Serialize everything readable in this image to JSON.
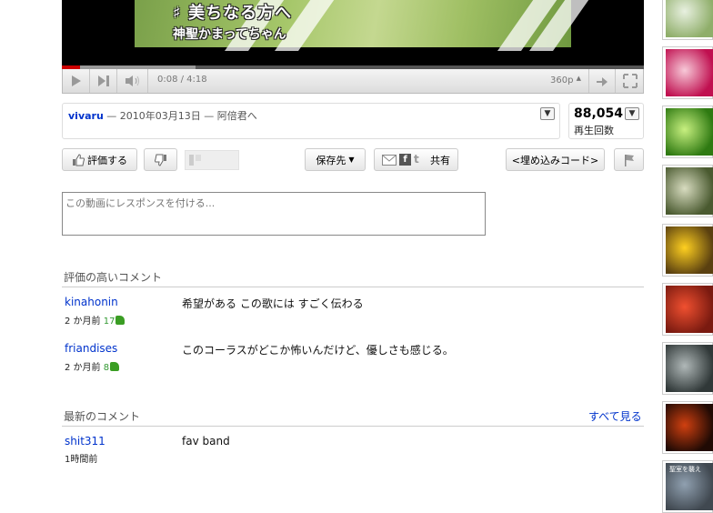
{
  "video": {
    "caption_line1": "♯ 美ちなる方へ",
    "caption_line2": "神聖かまってちゃん"
  },
  "player": {
    "time": "0:08 / 4:18",
    "quality": "360p",
    "progress_fraction": 0.032,
    "loaded_fraction": 0.23
  },
  "info": {
    "author": "vivaru",
    "separator1": " — ",
    "date": "2010年03月13日",
    "separator2": " — ",
    "description": "阿倍君へ"
  },
  "views": {
    "count": "88,054",
    "label": "再生回数"
  },
  "actions": {
    "like_label": "評価する",
    "save_label": "保存先",
    "share_label": "共有",
    "embed_label": "<埋め込みコード>"
  },
  "response": {
    "placeholder": "この動画にレスポンスを付ける..."
  },
  "top_comments": {
    "title": "評価の高いコメント",
    "items": [
      {
        "user": "kinahonin",
        "age": "2 か月前",
        "likes": "17",
        "text": "希望がある  この歌には   すごく伝わる"
      },
      {
        "user": "friandises",
        "age": "2 か月前",
        "likes": "8",
        "text": "このコーラスがどこか怖いんだけど、優しさも感じる。"
      }
    ]
  },
  "recent_comments": {
    "title": "最新のコメント",
    "see_all": "すべて見る",
    "items": [
      {
        "user": "shit311",
        "age": "1時間前",
        "text": "fav band"
      }
    ]
  },
  "sidebar": {
    "thumbnails": [
      {
        "colors": [
          "#8fae6a",
          "#e8f0e0"
        ]
      },
      {
        "colors": [
          "#c01050",
          "#f7c9d8"
        ]
      },
      {
        "colors": [
          "#2f7a12",
          "#c8f080"
        ]
      },
      {
        "colors": [
          "#4a5a30",
          "#d8dcc0"
        ]
      },
      {
        "colors": [
          "#5a4010",
          "#ffd020"
        ]
      },
      {
        "colors": [
          "#7a1a10",
          "#f05030"
        ]
      },
      {
        "colors": [
          "#303838",
          "#b0b8b8"
        ]
      },
      {
        "colors": [
          "#200a04",
          "#d04010"
        ]
      },
      {
        "colors": [
          "#404850",
          "#90a0b0"
        ]
      }
    ],
    "last_caption": "聖室を襲え"
  }
}
